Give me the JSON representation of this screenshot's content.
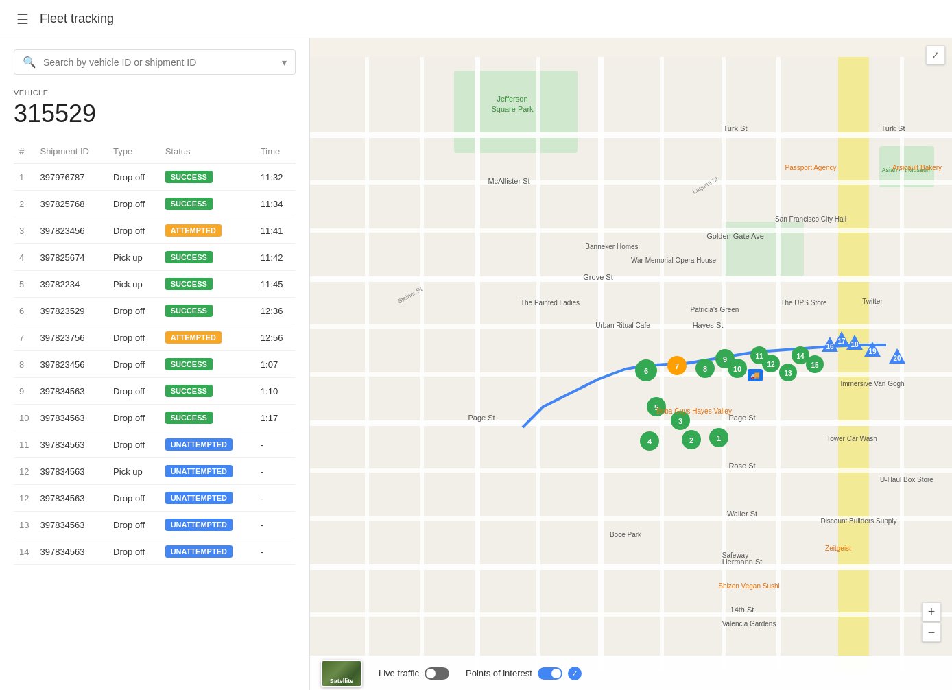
{
  "header": {
    "menu_icon": "☰",
    "title": "Fleet tracking"
  },
  "sidebar": {
    "search": {
      "placeholder": "Search by vehicle ID or shipment ID",
      "icon": "🔍"
    },
    "vehicle_label": "VEHICLE",
    "vehicle_id": "315529",
    "table": {
      "columns": [
        "#",
        "Shipment ID",
        "Type",
        "Status",
        "Time"
      ],
      "rows": [
        {
          "num": 1,
          "shipment_id": "397976787",
          "type": "Drop off",
          "status": "SUCCESS",
          "status_class": "badge-success",
          "time": "11:32"
        },
        {
          "num": 2,
          "shipment_id": "397825768",
          "type": "Drop off",
          "status": "SUCCESS",
          "status_class": "badge-success",
          "time": "11:34"
        },
        {
          "num": 3,
          "shipment_id": "397823456",
          "type": "Drop off",
          "status": "ATTEMPTED",
          "status_class": "badge-attempted",
          "time": "11:41"
        },
        {
          "num": 4,
          "shipment_id": "397825674",
          "type": "Pick up",
          "status": "SUCCESS",
          "status_class": "badge-success",
          "time": "11:42"
        },
        {
          "num": 5,
          "shipment_id": "39782234",
          "type": "Pick up",
          "status": "SUCCESS",
          "status_class": "badge-success",
          "time": "11:45"
        },
        {
          "num": 6,
          "shipment_id": "397823529",
          "type": "Drop off",
          "status": "SUCCESS",
          "status_class": "badge-success",
          "time": "12:36"
        },
        {
          "num": 7,
          "shipment_id": "397823756",
          "type": "Drop off",
          "status": "ATTEMPTED",
          "status_class": "badge-attempted",
          "time": "12:56"
        },
        {
          "num": 8,
          "shipment_id": "397823456",
          "type": "Drop off",
          "status": "SUCCESS",
          "status_class": "badge-success",
          "time": "1:07"
        },
        {
          "num": 9,
          "shipment_id": "397834563",
          "type": "Drop off",
          "status": "SUCCESS",
          "status_class": "badge-success",
          "time": "1:10"
        },
        {
          "num": 10,
          "shipment_id": "397834563",
          "type": "Drop off",
          "status": "SUCCESS",
          "status_class": "badge-success",
          "time": "1:17"
        },
        {
          "num": 11,
          "shipment_id": "397834563",
          "type": "Drop off",
          "status": "UNATTEMPTED",
          "status_class": "badge-unattempted",
          "time": "-"
        },
        {
          "num": 12,
          "shipment_id": "397834563",
          "type": "Pick up",
          "status": "UNATTEMPTED",
          "status_class": "badge-unattempted",
          "time": "-"
        },
        {
          "num": 12,
          "shipment_id": "397834563",
          "type": "Drop off",
          "status": "UNATTEMPTED",
          "status_class": "badge-unattempted",
          "time": "-"
        },
        {
          "num": 13,
          "shipment_id": "397834563",
          "type": "Drop off",
          "status": "UNATTEMPTED",
          "status_class": "badge-unattempted",
          "time": "-"
        },
        {
          "num": 14,
          "shipment_id": "397834563",
          "type": "Drop off",
          "status": "UNATTEMPTED",
          "status_class": "badge-unattempted",
          "time": "-"
        }
      ]
    }
  },
  "map": {
    "live_traffic_label": "Live traffic",
    "poi_label": "Points of interest",
    "satellite_label": "Satellite",
    "zoom_in": "+",
    "zoom_out": "−"
  }
}
